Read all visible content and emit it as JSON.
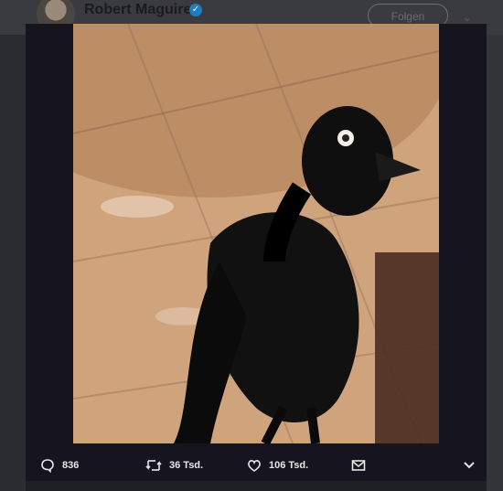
{
  "header": {
    "author_name": "Robert Maguire",
    "verified_glyph": "✓",
    "follow_label": "Folgen",
    "menu_icon": "chevron-down-icon"
  },
  "media": {
    "subject": "black-bird-photo"
  },
  "actions": {
    "reply_count": "836",
    "retweet_count": "36 Tsd.",
    "like_count": "106 Tsd.",
    "dm_icon": "envelope-icon",
    "more_icon": "chevron-down-icon"
  }
}
